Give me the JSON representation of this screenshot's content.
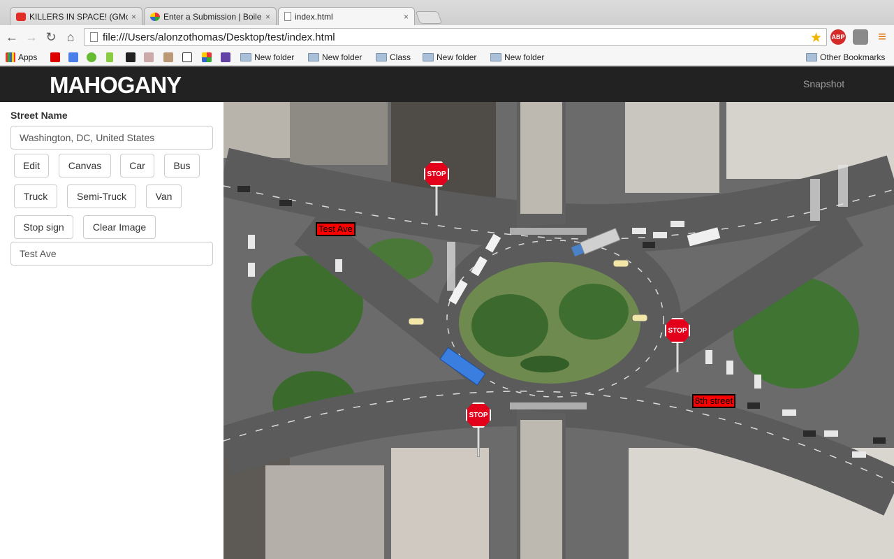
{
  "browser": {
    "tabs": [
      {
        "label": "KILLERS IN SPACE! (GMod:",
        "close": "×"
      },
      {
        "label": "Enter a Submission | Boiler",
        "close": "×"
      },
      {
        "label": "index.html",
        "close": "×"
      }
    ],
    "url": "file:///Users/alonzothomas/Desktop/test/index.html",
    "extensions": {
      "adblock": "ABP"
    },
    "bookmarks": [
      {
        "label": "Apps"
      },
      {
        "label": "New folder"
      },
      {
        "label": "New folder"
      },
      {
        "label": "Class"
      },
      {
        "label": "New folder"
      },
      {
        "label": "New folder"
      }
    ],
    "other_bookmarks": "Other Bookmarks"
  },
  "app": {
    "brand": "MAHOGANY",
    "nav_snapshot": "Snapshot"
  },
  "sidebar": {
    "street_label": "Street Name",
    "street_value": "Washington, DC, United States",
    "buttons": {
      "edit": "Edit",
      "canvas": "Canvas",
      "car": "Car",
      "bus": "Bus",
      "truck": "Truck",
      "semi_truck": "Semi-Truck",
      "van": "Van",
      "stop_sign": "Stop sign",
      "clear_image": "Clear Image"
    },
    "label_value": "Test Ave"
  },
  "map": {
    "labels": [
      "Test Ave",
      "8th street"
    ],
    "stop_text": "STOP"
  },
  "colors": {
    "header_bg": "#222222",
    "label_bg": "#ff0000",
    "stop_red": "#e3001b",
    "bus_blue": "#3a7fe0"
  }
}
